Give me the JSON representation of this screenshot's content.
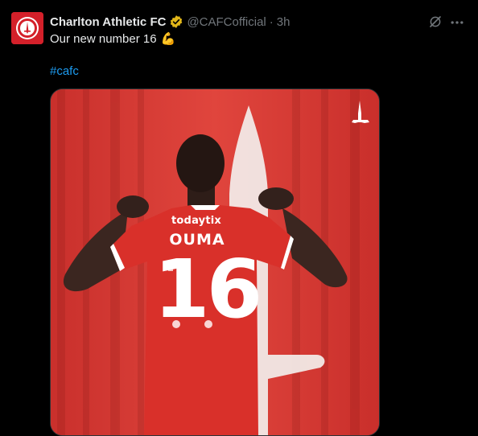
{
  "tweet": {
    "author_name": "Charlton Athletic FC",
    "handle": "@CAFCofficial",
    "separator": "·",
    "time": "3h",
    "text": "Our new number 16",
    "emoji": "💪",
    "hashtag": "#cafc"
  },
  "media": {
    "shirt_sponsor": "todaytix",
    "shirt_name": "OUMA",
    "shirt_number": "16"
  },
  "icons": {
    "avatar": "charlton-crest-icon",
    "verified": "verified-badge-icon",
    "grok": "grok-icon",
    "more": "more-options-icon",
    "watermark": "sword-logo-icon"
  },
  "colors": {
    "background": "#000000",
    "text": "#e7e9ea",
    "muted": "#71767b",
    "link": "#1d9bf0",
    "club_red": "#d4202a",
    "verified_gold": "#e2b719"
  }
}
